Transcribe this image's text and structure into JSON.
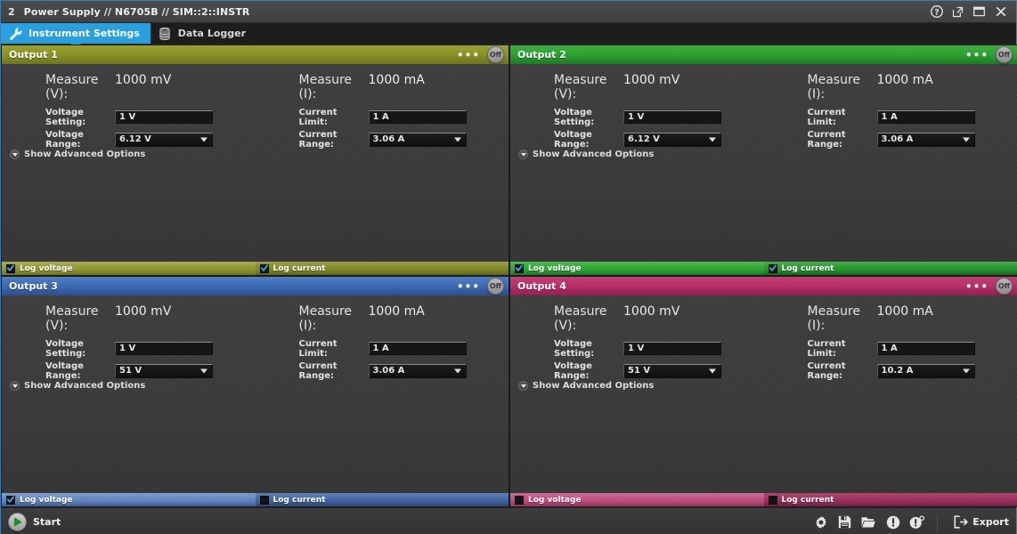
{
  "titlebar": {
    "index": "2",
    "title": "Power Supply // N6705B // SIM::2::INSTR",
    "buttons": [
      {
        "name": "help-icon",
        "label": "?"
      },
      {
        "name": "popout-icon",
        "label": ""
      },
      {
        "name": "maximize-icon",
        "label": ""
      },
      {
        "name": "close-icon",
        "label": "✕"
      }
    ]
  },
  "tabs": [
    {
      "label": "Instrument Settings",
      "icon": "wrench-icon",
      "active": true
    },
    {
      "label": "Data Logger",
      "icon": "database-icon",
      "active": false
    }
  ],
  "labels": {
    "measure_v": "Measure (V):",
    "measure_i": "Measure (I):",
    "voltage_setting": "Voltage Setting:",
    "current_limit": "Current Limit:",
    "voltage_range": "Voltage Range:",
    "current_range": "Current Range:",
    "show_advanced": "Show Advanced Options",
    "log_voltage": "Log voltage",
    "log_current": "Log current",
    "off": "Off",
    "dots": "•••"
  },
  "outputs": [
    {
      "title": "Output 1",
      "theme": "olive",
      "accent": "#8d9328",
      "state": "Off",
      "measure_v_value": "1000 mV",
      "measure_i_value": "1000 mA",
      "voltage_setting": "1 V",
      "current_limit": "1 A",
      "voltage_range": "6.12 V",
      "current_range": "3.06 A",
      "log_voltage_checked": true,
      "log_current_checked": true
    },
    {
      "title": "Output 2",
      "theme": "green",
      "accent": "#2fa234",
      "state": "Off",
      "measure_v_value": "1000 mV",
      "measure_i_value": "1000 mA",
      "voltage_setting": "1 V",
      "current_limit": "1 A",
      "voltage_range": "6.12 V",
      "current_range": "3.06 A",
      "log_voltage_checked": true,
      "log_current_checked": true
    },
    {
      "title": "Output 3",
      "theme": "blue",
      "accent": "#3f6cb4",
      "state": "Off",
      "measure_v_value": "1000 mV",
      "measure_i_value": "1000 mA",
      "voltage_setting": "1 V",
      "current_limit": "1 A",
      "voltage_range": "51 V",
      "current_range": "3.06 A",
      "log_voltage_checked": true,
      "log_current_checked": false
    },
    {
      "title": "Output 4",
      "theme": "pink",
      "accent": "#b8306a",
      "state": "Off",
      "measure_v_value": "1000 mV",
      "measure_i_value": "1000 mA",
      "voltage_setting": "1 V",
      "current_limit": "1 A",
      "voltage_range": "51 V",
      "current_range": "10.2 A",
      "log_voltage_checked": false,
      "log_current_checked": false
    }
  ],
  "bottombar": {
    "start_label": "Start",
    "export_label": "Export",
    "icons": [
      {
        "name": "gear-icon"
      },
      {
        "name": "save-icon"
      },
      {
        "name": "open-folder-icon"
      },
      {
        "name": "error-indicator-icon"
      },
      {
        "name": "warning-indicator-icon"
      }
    ]
  },
  "colors": {
    "accent_blue": "#29a0dd",
    "window_border": "#3a7fb5",
    "panel_bg": "#3b3b3b",
    "titlebar_bg": "#444444"
  }
}
